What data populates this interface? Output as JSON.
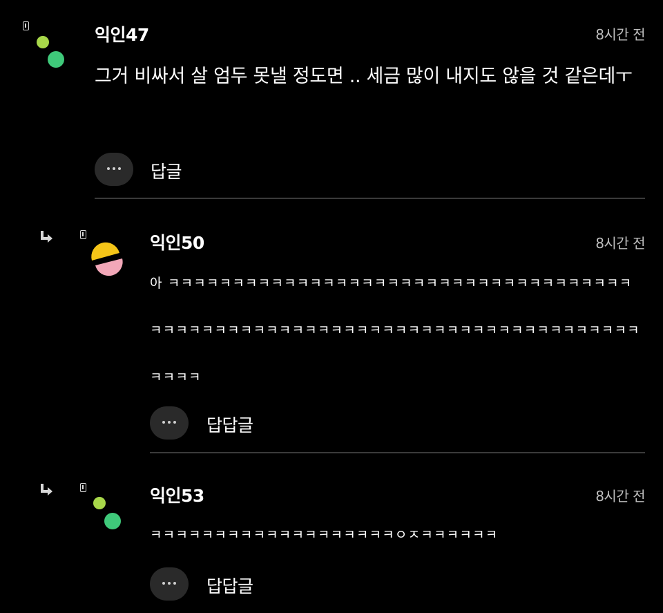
{
  "colors": {
    "background": "#000000",
    "text": "#ffffff",
    "timestamp": "#bdbdbd",
    "divider": "#3a3a3a",
    "button_bg": "#2a2a2a",
    "avatar_green_light": "#a8d84a",
    "avatar_green": "#3fc97a",
    "avatar_yellow": "#f5c518",
    "avatar_pink": "#f2a7b8"
  },
  "comments": [
    {
      "nickname": "익인47",
      "time": "8시간 전",
      "text": "그거 비싸서 살 엄두 못낼 정도면 .. 세금 많이 내지도 않을 것 같은데ㅜ",
      "reply_label": "답글",
      "avatar_icon": "two-dots-avatar-icon",
      "badge_icon": "phone-badge-icon"
    },
    {
      "nickname": "익인50",
      "time": "8시간 전",
      "text": "아 ㅋㅋㅋㅋㅋㅋㅋㅋㅋㅋㅋㅋㅋㅋㅋㅋㅋㅋㅋㅋㅋㅋㅋㅋㅋㅋㅋㅋㅋㅋㅋㅋㅋㅋㅋㅋㅋㅋㅋㅋㅋㅋㅋㅋㅋㅋㅋㅋㅋㅋㅋㅋㅋㅋㅋㅋㅋㅋㅋㅋㅋㅋㅋㅋㅋㅋㅋㅋㅋㅋㅋㅋㅋㅋㅋㅋㅋㅋ",
      "reply_label": "답답글",
      "avatar_icon": "half-circles-avatar-icon",
      "badge_icon": "phone-badge-icon",
      "reply_arrow_icon": "reply-arrow-icon"
    },
    {
      "nickname": "익인53",
      "time": "8시간 전",
      "text": "ㅋㅋㅋㅋㅋㅋㅋㅋㅋㅋㅋㅋㅋㅋㅋㅋㅋㅋㅋㅇㅈㅋㅋㅋㅋㅋㅋ",
      "reply_label": "답답글",
      "avatar_icon": "two-dots-avatar-icon",
      "badge_icon": "phone-badge-icon",
      "reply_arrow_icon": "reply-arrow-icon"
    }
  ]
}
